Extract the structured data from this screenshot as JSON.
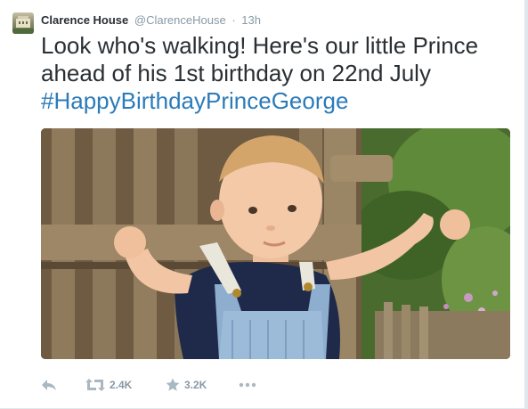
{
  "tweet": {
    "fullname": "Clarence House",
    "screen_name": "@ClarenceHouse",
    "separator": "·",
    "time": "13h",
    "text_line1": "Look who's walking! Here's our little Prince",
    "text_line2": "ahead of his 1st birthday on 22nd July",
    "hashtag": "#HappyBirthdayPrinceGeorge",
    "hashtag_color": "#2b7bb9"
  },
  "actions": {
    "reply_icon": "reply-icon",
    "retweet_icon": "retweet-icon",
    "retweet_count": "2.4K",
    "favorite_icon": "star-icon",
    "favorite_count": "3.2K",
    "more_icon": "more-icon"
  },
  "colors": {
    "text": "#292f33",
    "muted": "#8899a6",
    "icon": "#aab8c2"
  }
}
